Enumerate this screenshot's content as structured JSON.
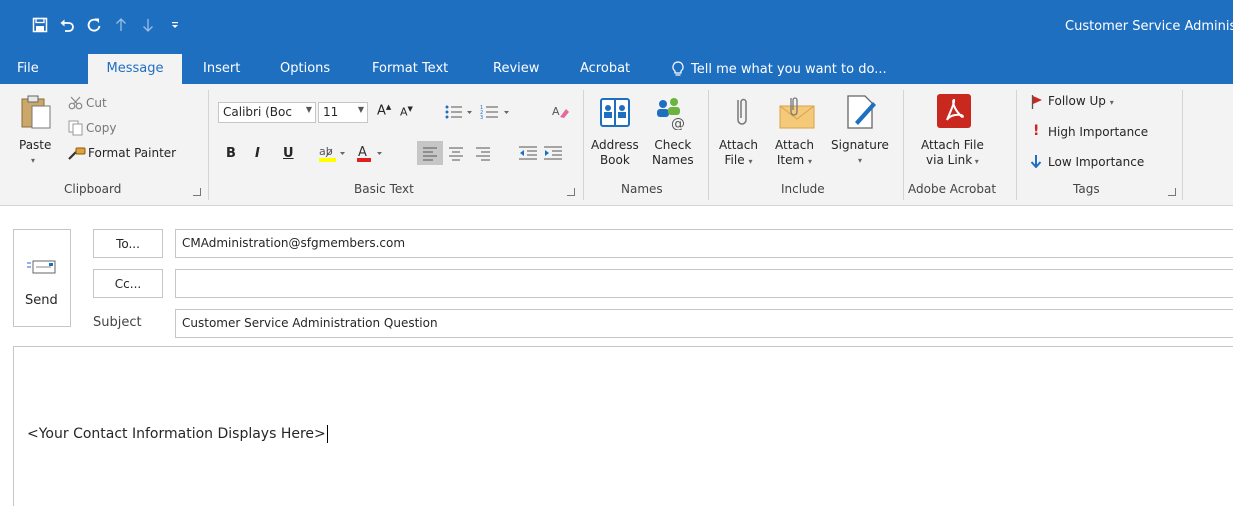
{
  "window": {
    "title": "Customer Service Adminis",
    "accent_color": "#1f6fc1"
  },
  "qat": {
    "icons": [
      "save-icon",
      "undo-icon",
      "redo-icon",
      "up-arrow-icon",
      "down-arrow-icon",
      "customize-icon"
    ]
  },
  "tabs": {
    "file": "File",
    "message": "Message",
    "insert": "Insert",
    "options": "Options",
    "format_text": "Format Text",
    "review": "Review",
    "acrobat": "Acrobat",
    "tell_me": "Tell me what you want to do..."
  },
  "ribbon": {
    "clipboard": {
      "label": "Clipboard",
      "paste": "Paste",
      "cut": "Cut",
      "copy": "Copy",
      "format_painter": "Format Painter"
    },
    "basic_text": {
      "label": "Basic Text",
      "font": "Calibri (Boc",
      "size": "11",
      "bold": "B",
      "italic": "I",
      "underline": "U"
    },
    "names": {
      "label": "Names",
      "address_book_1": "Address",
      "address_book_2": "Book",
      "check_names_1": "Check",
      "check_names_2": "Names"
    },
    "include": {
      "label": "Include",
      "attach_file_1": "Attach",
      "attach_file_2": "File",
      "attach_item_1": "Attach",
      "attach_item_2": "Item",
      "signature": "Signature"
    },
    "adobe": {
      "label": "Adobe Acrobat",
      "attach_1": "Attach File",
      "attach_2": "via Link",
      "icon_color": "#c8281e"
    },
    "tags": {
      "label": "Tags",
      "follow_up": "Follow Up",
      "high": "High Importance",
      "low": "Low Importance",
      "follow_up_color": "#c8281e",
      "high_color": "#c8281e",
      "low_color": "#1f6fc1"
    }
  },
  "compose": {
    "send": "Send",
    "to_button": "To...",
    "cc_button": "Cc...",
    "subject_label": "Subject",
    "to_value": "CMAdministration@sfgmembers.com",
    "cc_value": "",
    "subject_value": "Customer Service Administration Question",
    "body_text": "<Your Contact Information Displays Here>"
  }
}
